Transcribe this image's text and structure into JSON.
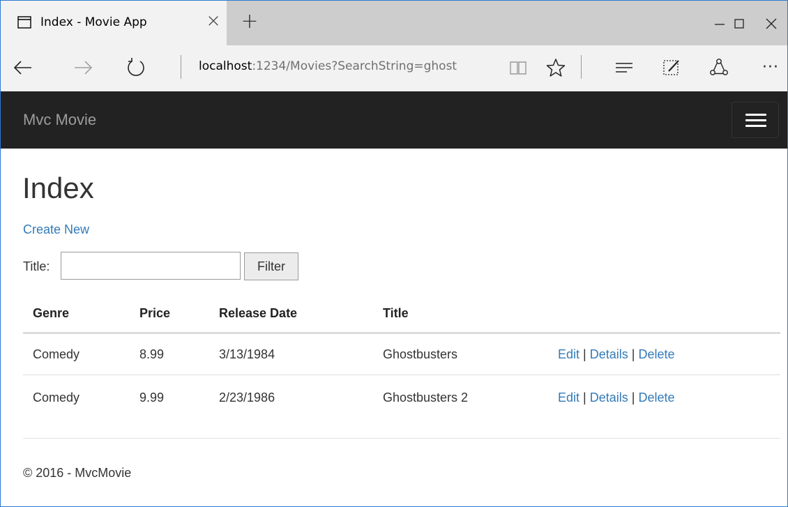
{
  "browser": {
    "tab_title": "Index - Movie App",
    "url_host": "localhost",
    "url_rest": ":1234/Movies?SearchString=ghost"
  },
  "site": {
    "brand": "Mvc Movie"
  },
  "page": {
    "title": "Index",
    "create_link": "Create New",
    "filter_label": "Title:",
    "filter_value": "",
    "filter_button": "Filter"
  },
  "table": {
    "headers": [
      "Genre",
      "Price",
      "Release Date",
      "Title"
    ],
    "rows": [
      {
        "genre": "Comedy",
        "price": "8.99",
        "release_date": "3/13/1984",
        "title": "Ghostbusters"
      },
      {
        "genre": "Comedy",
        "price": "9.99",
        "release_date": "2/23/1986",
        "title": "Ghostbusters 2"
      }
    ],
    "actions": {
      "edit": "Edit",
      "details": "Details",
      "delete": "Delete",
      "separator": "|"
    }
  },
  "footer": {
    "text": "© 2016 - MvcMovie"
  },
  "colors": {
    "navbar_bg": "#222222",
    "link": "#337ab7",
    "window_border": "#2b79d0"
  },
  "icons": [
    "tab-page-icon",
    "close-icon",
    "new-tab-icon",
    "minimize-icon",
    "maximize-icon",
    "window-close-icon",
    "back-icon",
    "forward-icon",
    "refresh-icon",
    "reading-view-icon",
    "favorite-star-icon",
    "hub-icon",
    "web-note-icon",
    "share-icon",
    "more-icon",
    "hamburger-icon"
  ]
}
